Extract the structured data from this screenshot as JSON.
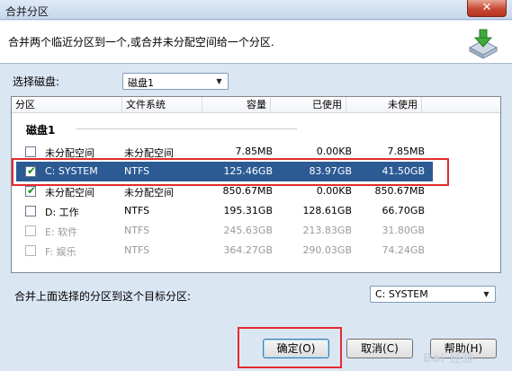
{
  "window": {
    "title": "合并分区",
    "close_label": "✕"
  },
  "header": {
    "description": "合并两个临近分区到一个,或合并未分配空间给一个分区."
  },
  "disk_select": {
    "label": "选择磁盘:",
    "value": "磁盘1"
  },
  "columns": [
    "分区",
    "文件系统",
    "容量",
    "已使用",
    "未使用"
  ],
  "group": {
    "title": "磁盘1"
  },
  "partitions": [
    {
      "checked": false,
      "name": "未分配空间",
      "fs": "未分配空间",
      "capacity": "7.85MB",
      "used": "0.00KB",
      "unused": "7.85MB",
      "state": "normal"
    },
    {
      "checked": true,
      "name": "C: SYSTEM",
      "fs": "NTFS",
      "capacity": "125.46GB",
      "used": "83.97GB",
      "unused": "41.50GB",
      "state": "selected"
    },
    {
      "checked": true,
      "name": "未分配空间",
      "fs": "未分配空间",
      "capacity": "850.67MB",
      "used": "0.00KB",
      "unused": "850.67MB",
      "state": "normal"
    },
    {
      "checked": false,
      "name": "D: 工作",
      "fs": "NTFS",
      "capacity": "195.31GB",
      "used": "128.61GB",
      "unused": "66.70GB",
      "state": "normal"
    },
    {
      "checked": false,
      "name": "E: 软件",
      "fs": "NTFS",
      "capacity": "245.63GB",
      "used": "213.83GB",
      "unused": "31.80GB",
      "state": "disabled"
    },
    {
      "checked": false,
      "name": "F: 娱乐",
      "fs": "NTFS",
      "capacity": "364.27GB",
      "used": "290.03GB",
      "unused": "74.24GB",
      "state": "disabled"
    }
  ],
  "target": {
    "label": "合并上面选择的分区到这个目标分区:",
    "value": "C: SYSTEM"
  },
  "buttons": {
    "ok": "确定(O)",
    "cancel": "取消(C)",
    "help": "帮助(H)"
  },
  "watermark": "Bai 经验",
  "colors": {
    "selection": "#2c5b94",
    "highlight_box": "#e32c2c",
    "check": "#1d8a1d"
  },
  "icons": [
    "close-icon",
    "merge-disk-icon",
    "chevron-down-icon",
    "check-icon"
  ]
}
